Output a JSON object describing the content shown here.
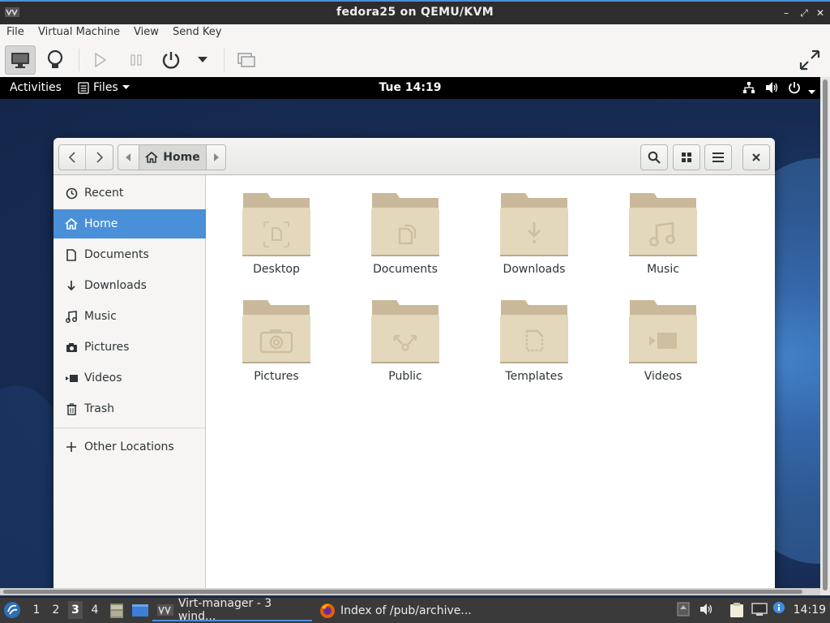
{
  "host": {
    "title": "fedora25 on QEMU/KVM",
    "menu": [
      "File",
      "Virtual Machine",
      "View",
      "Send Key"
    ]
  },
  "topbar": {
    "activities": "Activities",
    "app_menu": "Files",
    "clock": "Tue 14:19"
  },
  "nautilus": {
    "path_current": "Home",
    "sidebar": [
      {
        "label": "Recent",
        "icon": "clock-icon"
      },
      {
        "label": "Home",
        "icon": "home-icon",
        "selected": true
      },
      {
        "label": "Documents",
        "icon": "document-icon"
      },
      {
        "label": "Downloads",
        "icon": "download-icon"
      },
      {
        "label": "Music",
        "icon": "music-note-icon"
      },
      {
        "label": "Pictures",
        "icon": "camera-icon"
      },
      {
        "label": "Videos",
        "icon": "video-icon"
      },
      {
        "label": "Trash",
        "icon": "trash-icon"
      }
    ],
    "other_locations": "Other Locations",
    "folders": [
      {
        "label": "Desktop",
        "emblem": "desktop"
      },
      {
        "label": "Documents",
        "emblem": "documents"
      },
      {
        "label": "Downloads",
        "emblem": "downloads"
      },
      {
        "label": "Music",
        "emblem": "music"
      },
      {
        "label": "Pictures",
        "emblem": "pictures"
      },
      {
        "label": "Public",
        "emblem": "public"
      },
      {
        "label": "Templates",
        "emblem": "templates"
      },
      {
        "label": "Videos",
        "emblem": "videos"
      }
    ]
  },
  "taskbar": {
    "workspaces": [
      "1",
      "2",
      "3",
      "4"
    ],
    "active_workspace": "3",
    "tasks": [
      {
        "label": "Virt-manager - 3 wind...",
        "active": true
      },
      {
        "label": "Index of /pub/archive...",
        "active": false
      }
    ],
    "clock": "14:19"
  },
  "colors": {
    "accent": "#4a90d9",
    "folder": "#e3d7bc",
    "folder_tab": "#c9b99a"
  }
}
